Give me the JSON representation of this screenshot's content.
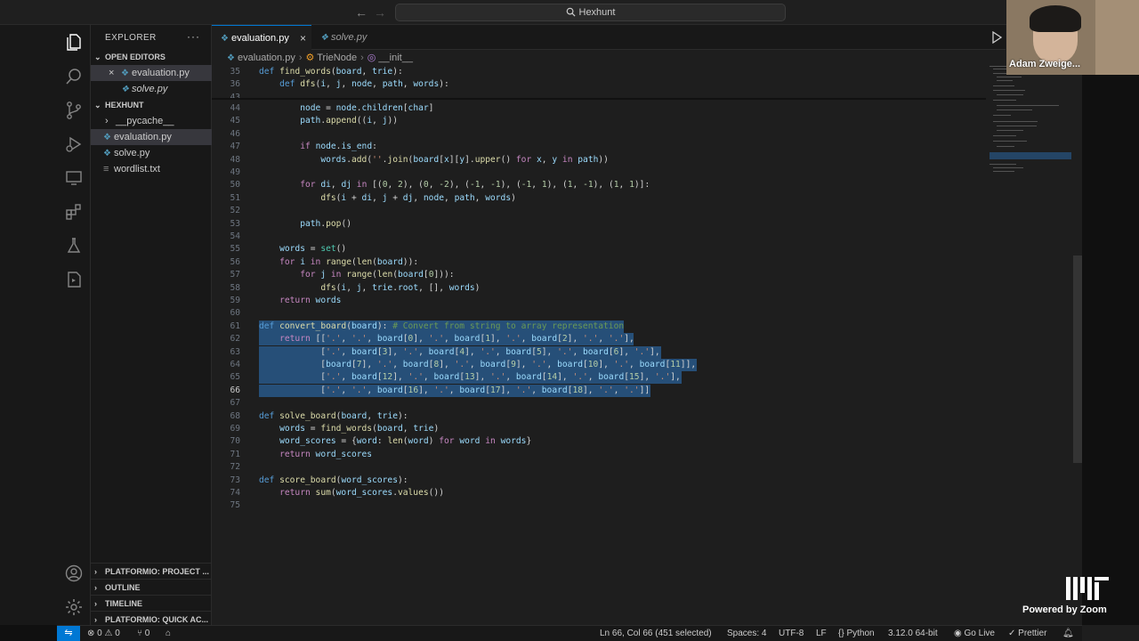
{
  "titlebar": {
    "search_label": "Hexhunt",
    "back": "←",
    "forward": "→"
  },
  "sidebar": {
    "title": "EXPLORER",
    "more": "···",
    "open_editors_header": "OPEN EDITORS",
    "open_editors": [
      {
        "label": "evaluation.py",
        "close": "×",
        "icon": "python-file-icon"
      },
      {
        "label": "solve.py",
        "icon": "python-file-icon"
      }
    ],
    "folder_header": "HEXHUNT",
    "files": [
      {
        "label": "__pycache__",
        "chevron": "›"
      },
      {
        "label": "evaluation.py"
      },
      {
        "label": "solve.py"
      },
      {
        "label": "wordlist.txt"
      }
    ],
    "bottom_sections": [
      {
        "label": "PLATFORMIO: PROJECT ..."
      },
      {
        "label": "OUTLINE"
      },
      {
        "label": "TIMELINE"
      },
      {
        "label": "PLATFORMIO: QUICK AC..."
      }
    ]
  },
  "tabs": [
    {
      "label": "evaluation.py",
      "close": "×"
    },
    {
      "label": "solve.py"
    }
  ],
  "breadcrumb": {
    "file": "evaluation.py",
    "class": "TrieNode",
    "member": "__init__"
  },
  "editor": {
    "sticky": [
      {
        "n": "35",
        "html": "<span class='kd'>def</span> <span class='fn'>find_words</span>(<span class='vr'>board</span>, <span class='vr'>trie</span>):"
      },
      {
        "n": "36",
        "html": "    <span class='kd'>def</span> <span class='fn'>dfs</span>(<span class='vr'>i</span>, <span class='vr'>j</span>, <span class='vr'>node</span>, <span class='vr'>path</span>, <span class='vr'>words</span>):"
      },
      {
        "n": "43",
        "html": ""
      }
    ],
    "lines": [
      {
        "n": "44",
        "html": "        <span class='vr'>node</span> = <span class='vr'>node</span>.<span class='vr'>children</span>[<span class='vr'>char</span>]"
      },
      {
        "n": "45",
        "html": "        <span class='vr'>path</span>.<span class='fn'>append</span>((<span class='vr'>i</span>, <span class='vr'>j</span>))"
      },
      {
        "n": "46",
        "html": ""
      },
      {
        "n": "47",
        "html": "        <span class='kw'>if</span> <span class='vr'>node</span>.<span class='vr'>is_end</span>:"
      },
      {
        "n": "48",
        "html": "            <span class='vr'>words</span>.<span class='fn'>add</span>(<span class='st'>''</span>.<span class='fn'>join</span>(<span class='vr'>board</span>[<span class='vr'>x</span>][<span class='vr'>y</span>].<span class='fn'>upper</span>() <span class='kw'>for</span> <span class='vr'>x</span>, <span class='vr'>y</span> <span class='kw'>in</span> <span class='vr'>path</span>))"
      },
      {
        "n": "49",
        "html": ""
      },
      {
        "n": "50",
        "html": "        <span class='kw'>for</span> <span class='vr'>di</span>, <span class='vr'>dj</span> <span class='kw'>in</span> [(<span class='nu'>0</span>, <span class='nu'>2</span>), (<span class='nu'>0</span>, <span class='nu'>-2</span>), (<span class='nu'>-1</span>, <span class='nu'>-1</span>), (<span class='nu'>-1</span>, <span class='nu'>1</span>), (<span class='nu'>1</span>, <span class='nu'>-1</span>), (<span class='nu'>1</span>, <span class='nu'>1</span>)]:"
      },
      {
        "n": "51",
        "html": "            <span class='fn'>dfs</span>(<span class='vr'>i</span> + <span class='vr'>di</span>, <span class='vr'>j</span> + <span class='vr'>dj</span>, <span class='vr'>node</span>, <span class='vr'>path</span>, <span class='vr'>words</span>)"
      },
      {
        "n": "52",
        "html": ""
      },
      {
        "n": "53",
        "html": "        <span class='vr'>path</span>.<span class='fn'>pop</span>()"
      },
      {
        "n": "54",
        "html": ""
      },
      {
        "n": "55",
        "html": "    <span class='vr'>words</span> = <span class='cl'>set</span>()"
      },
      {
        "n": "56",
        "html": "    <span class='kw'>for</span> <span class='vr'>i</span> <span class='kw'>in</span> <span class='fn'>range</span>(<span class='fn'>len</span>(<span class='vr'>board</span>)):"
      },
      {
        "n": "57",
        "html": "        <span class='kw'>for</span> <span class='vr'>j</span> <span class='kw'>in</span> <span class='fn'>range</span>(<span class='fn'>len</span>(<span class='vr'>board</span>[<span class='nu'>0</span>])):"
      },
      {
        "n": "58",
        "html": "            <span class='fn'>dfs</span>(<span class='vr'>i</span>, <span class='vr'>j</span>, <span class='vr'>trie</span>.<span class='vr'>root</span>, [], <span class='vr'>words</span>)"
      },
      {
        "n": "59",
        "html": "    <span class='kw'>return</span> <span class='vr'>words</span>"
      },
      {
        "n": "60",
        "html": ""
      },
      {
        "n": "61",
        "html": "<span class='kd'>def</span> <span class='fn'>convert_board</span>(<span class='vr'>board</span>): <span class='cm'># Convert from string to array representation</span>"
      },
      {
        "n": "62",
        "html": "    <span class='kw'>return</span> [[<span class='st'>'.'</span>, <span class='st'>'.'</span>, <span class='vr'>board</span>[<span class='nu'>0</span>], <span class='st'>'.'</span>, <span class='vr'>board</span>[<span class='nu'>1</span>], <span class='st'>'.'</span>, <span class='vr'>board</span>[<span class='nu'>2</span>], <span class='st'>'.'</span>, <span class='st'>'.'</span>],"
      },
      {
        "n": "63",
        "html": "            [<span class='st'>'.'</span>, <span class='vr'>board</span>[<span class='nu'>3</span>], <span class='st'>'.'</span>, <span class='vr'>board</span>[<span class='nu'>4</span>], <span class='st'>'.'</span>, <span class='vr'>board</span>[<span class='nu'>5</span>], <span class='st'>'.'</span>, <span class='vr'>board</span>[<span class='nu'>6</span>], <span class='st'>'.'</span>],"
      },
      {
        "n": "64",
        "html": "            [<span class='vr'>board</span>[<span class='nu'>7</span>], <span class='st'>'.'</span>, <span class='vr'>board</span>[<span class='nu'>8</span>], <span class='st'>'.'</span>, <span class='vr'>board</span>[<span class='nu'>9</span>], <span class='st'>'.'</span>, <span class='vr'>board</span>[<span class='nu'>10</span>], <span class='st'>'.'</span>, <span class='vr'>board</span>[<span class='nu'>11</span>]],"
      },
      {
        "n": "65",
        "html": "            [<span class='st'>'.'</span>, <span class='vr'>board</span>[<span class='nu'>12</span>], <span class='st'>'.'</span>, <span class='vr'>board</span>[<span class='nu'>13</span>], <span class='st'>'.'</span>, <span class='vr'>board</span>[<span class='nu'>14</span>], <span class='st'>'.'</span>, <span class='vr'>board</span>[<span class='nu'>15</span>], <span class='st'>'.'</span>],"
      },
      {
        "n": "66",
        "html": "            [<span class='st'>'.'</span>, <span class='st'>'.'</span>, <span class='vr'>board</span>[<span class='nu'>16</span>], <span class='st'>'.'</span>, <span class='vr'>board</span>[<span class='nu'>17</span>], <span class='st'>'.'</span>, <span class='vr'>board</span>[<span class='nu'>18</span>], <span class='st'>'.'</span>, <span class='st'>'.'</span>]]"
      },
      {
        "n": "67",
        "html": ""
      },
      {
        "n": "68",
        "html": "<span class='kd'>def</span> <span class='fn'>solve_board</span>(<span class='vr'>board</span>, <span class='vr'>trie</span>):"
      },
      {
        "n": "69",
        "html": "    <span class='vr'>words</span> = <span class='fn'>find_words</span>(<span class='vr'>board</span>, <span class='vr'>trie</span>)"
      },
      {
        "n": "70",
        "html": "    <span class='vr'>word_scores</span> = {<span class='vr'>word</span>: <span class='fn'>len</span>(<span class='vr'>word</span>) <span class='kw'>for</span> <span class='vr'>word</span> <span class='kw'>in</span> <span class='vr'>words</span>}"
      },
      {
        "n": "71",
        "html": "    <span class='kw'>return</span> <span class='vr'>word_scores</span>"
      },
      {
        "n": "72",
        "html": ""
      },
      {
        "n": "73",
        "html": "<span class='kd'>def</span> <span class='fn'>score_board</span>(<span class='vr'>word_scores</span>):"
      },
      {
        "n": "74",
        "html": "    <span class='kw'>return</span> <span class='fn'>sum</span>(<span class='vr'>word_scores</span>.<span class='fn'>values</span>())"
      },
      {
        "n": "75",
        "html": ""
      }
    ],
    "selected_lines": [
      "61",
      "62",
      "63",
      "64",
      "65",
      "66"
    ],
    "current_line": "66"
  },
  "zoom": {
    "participant": "Adam Zweige...",
    "powered": "Powered by Zoom"
  },
  "statusbar": {
    "errors": "0",
    "warnings": "0",
    "ports": "0",
    "cursor": "Ln 66, Col 66 (451 selected)",
    "spaces": "Spaces: 4",
    "encoding": "UTF-8",
    "eol": "LF",
    "language": "Python",
    "interpreter": "3.12.0 64-bit",
    "golive": "Go Live",
    "prettier": "Prettier"
  },
  "colors": {
    "accent": "#0078d4",
    "selection": "#264f78",
    "python": "#519aba"
  }
}
